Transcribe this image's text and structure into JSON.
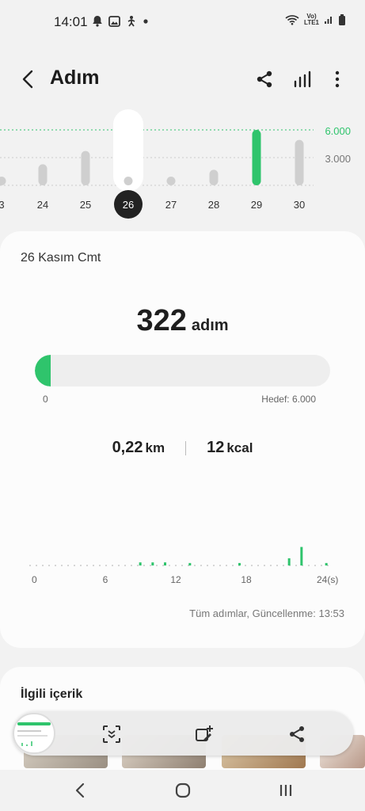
{
  "status_bar": {
    "time": "14:01",
    "net_top": "Vo)",
    "net_bottom": "LTE1"
  },
  "header": {
    "title": "Adım",
    "icons": [
      "back-icon",
      "share-icon",
      "chart-icon",
      "more-icon"
    ]
  },
  "week_strip": {
    "goal_label": "6.000",
    "mid_label": "3.000",
    "days": [
      {
        "label": "3",
        "steps_fraction": 0.02,
        "met_goal": false
      },
      {
        "label": "24",
        "steps_fraction": 0.38,
        "met_goal": false
      },
      {
        "label": "25",
        "steps_fraction": 0.62,
        "met_goal": false
      },
      {
        "label": "26",
        "steps_fraction": 0.05,
        "met_goal": false,
        "selected": true
      },
      {
        "label": "27",
        "steps_fraction": 0.02,
        "met_goal": false
      },
      {
        "label": "28",
        "steps_fraction": 0.28,
        "met_goal": false
      },
      {
        "label": "29",
        "steps_fraction": 1.0,
        "met_goal": true
      },
      {
        "label": "30",
        "steps_fraction": 0.82,
        "met_goal": false
      }
    ]
  },
  "day_card": {
    "date": "26 Kasım Cmt",
    "steps": "322",
    "steps_unit": "adım",
    "progress_fraction": 0.054,
    "min_label": "0",
    "goal_label": "Hedef: 6.000",
    "distance": "0,22",
    "distance_unit": "km",
    "calories": "12",
    "calories_unit": "kcal",
    "hourly_axis": [
      "0",
      "6",
      "12",
      "18",
      "24(s)"
    ],
    "hourly_steps_fraction": [
      0,
      0,
      0,
      0,
      0,
      0,
      0,
      0,
      0.15,
      0.15,
      0.15,
      0,
      0.12,
      0,
      0,
      0,
      0.12,
      0,
      0,
      0,
      0.35,
      0.9,
      0,
      0.12
    ],
    "updated": "Tüm adımlar, Güncellenme: 13:53"
  },
  "related": {
    "heading": "İlgili içerik"
  },
  "toolbar": {
    "icons": [
      "scroll-capture-icon",
      "edit-icon",
      "share-icon"
    ]
  },
  "nav": {
    "icons": [
      "nav-back-icon",
      "home-icon",
      "recents-icon"
    ]
  },
  "colors": {
    "accent": "#2fc46c",
    "bar_gray": "#cfcfcf",
    "selected_bg": "#ffffff"
  }
}
